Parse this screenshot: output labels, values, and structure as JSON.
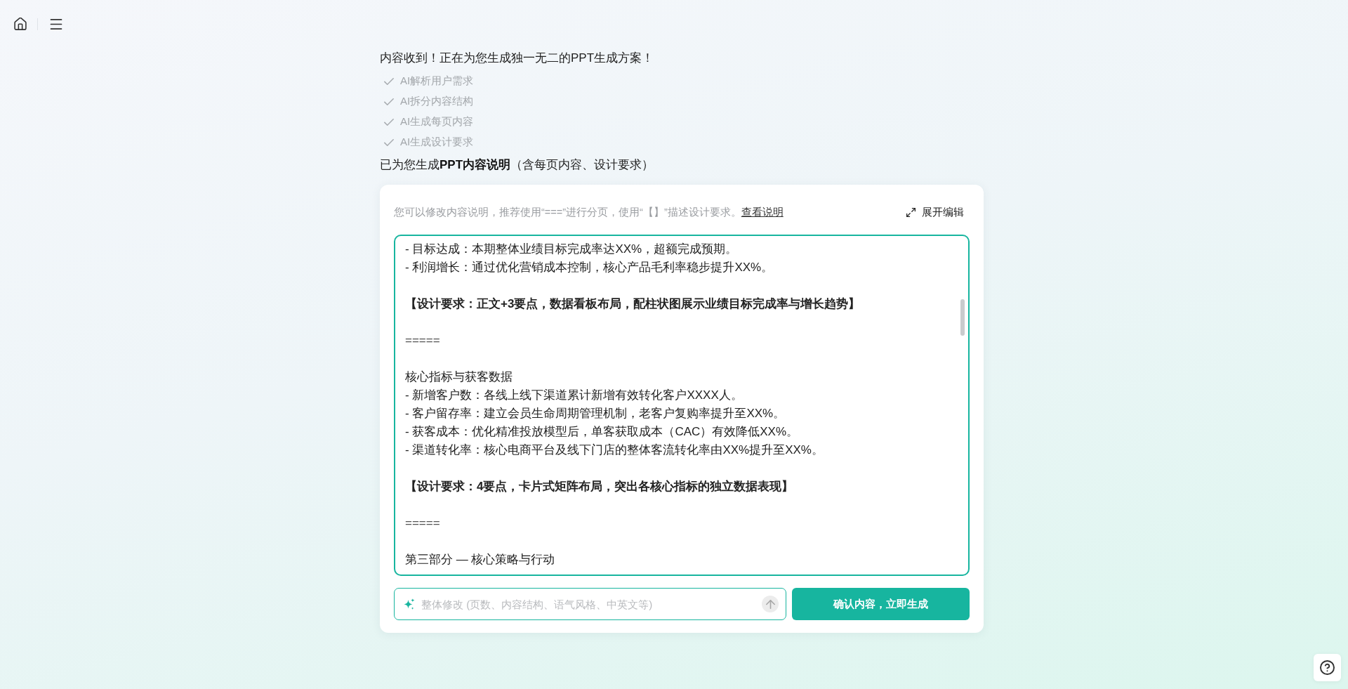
{
  "status": {
    "title": "内容收到！正在为您生成独一无二的PPT生成方案！",
    "steps": [
      {
        "label": "AI解析用户需求",
        "done": true
      },
      {
        "label": "AI拆分内容结构",
        "done": true
      },
      {
        "label": "AI生成每页内容",
        "done": true
      },
      {
        "label": "AI生成设计要求",
        "done": true
      }
    ]
  },
  "result_title": "已为您生成**PPT内容说明**（含每页内容、设计要求）",
  "editor_card": {
    "hint": "您可以修改内容说明，推荐使用“===”进行分页，使用“【】”描述设计要求。",
    "hint_link": "查看说明",
    "expand_label": "展开编辑",
    "blocks": [
      {
        "kind": "text",
        "lines": [
          "- 目标达成：本期整体业绩目标完成率达XX%，超额完成预期。",
          "- 利润增长：通过优化营销成本控制，核心产品毛利率稳步提升XX%。"
        ]
      },
      {
        "kind": "design",
        "text": "【设计要求：正文+3要点，数据看板布局，配柱状图展示业绩目标完成率与增长趋势】"
      },
      {
        "kind": "separator",
        "text": "====="
      },
      {
        "kind": "text",
        "lines": [
          "核心指标与获客数据",
          "- 新增客户数：各线上线下渠道累计新增有效转化客户XXXX人。",
          "- 客户留存率：建立会员生命周期管理机制，老客户复购率提升至XX%。",
          "- 获客成本：优化精准投放模型后，单客获取成本（CAC）有效降低XX%。",
          "- 渠道转化率：核心电商平台及线下门店的整体客流转化率由XX%提升至XX%。"
        ]
      },
      {
        "kind": "design",
        "text": "【设计要求：4要点，卡片式矩阵布局，突出各核心指标的独立数据表现】"
      },
      {
        "kind": "separator",
        "text": "====="
      },
      {
        "kind": "text",
        "lines": [
          "第三部分 — 核心策略与行动"
        ]
      }
    ]
  },
  "revise_input": {
    "placeholder": "整体修改 (页数、内容结构、语气风格、中英文等)"
  },
  "confirm_button": "确认内容，立即生成"
}
